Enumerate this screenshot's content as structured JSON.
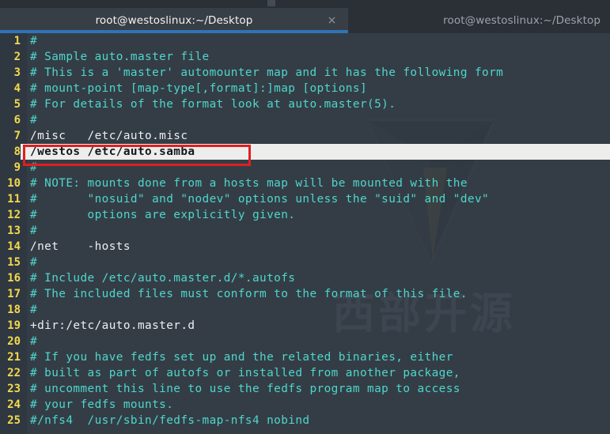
{
  "window": {
    "app": "terminal",
    "tabs": [
      {
        "label": "root@westoslinux:~/Desktop",
        "active": true,
        "close_icon": "×"
      },
      {
        "label": "root@westoslinux:~/Desktop",
        "active": false
      }
    ]
  },
  "colors": {
    "background": "#343d46",
    "gutter": "#2f3740",
    "tabbar": "#2b3036",
    "tab_active": "#383e45",
    "tab_underline": "#2f74b5",
    "line_number": "#f2d94e",
    "comment": "#4fd6cc",
    "plain_text": "#eceff1",
    "selection": "#edeeec",
    "annotation": "#e01f1f"
  },
  "watermark": {
    "text": "西部开源"
  },
  "editor": {
    "file": "auto.master",
    "highlighted_line": 8,
    "lines": [
      {
        "n": "1",
        "text": "#",
        "style": "comment"
      },
      {
        "n": "2",
        "text": "# Sample auto.master file",
        "style": "comment"
      },
      {
        "n": "3",
        "text": "# This is a 'master' automounter map and it has the following form",
        "style": "comment"
      },
      {
        "n": "4",
        "text": "# mount-point [map-type[,format]:]map [options]",
        "style": "comment"
      },
      {
        "n": "5",
        "text": "# For details of the format look at auto.master(5).",
        "style": "comment"
      },
      {
        "n": "6",
        "text": "#",
        "style": "comment"
      },
      {
        "n": "7",
        "text": "/misc\t/etc/auto.misc",
        "style": "plain"
      },
      {
        "n": "8",
        "text": "/westos /etc/auto.samba",
        "style": "selected"
      },
      {
        "n": "9",
        "text": "#",
        "style": "comment"
      },
      {
        "n": "10",
        "text": "# NOTE: mounts done from a hosts map will be mounted with the",
        "style": "comment"
      },
      {
        "n": "11",
        "text": "#       \"nosuid\" and \"nodev\" options unless the \"suid\" and \"dev\"",
        "style": "comment"
      },
      {
        "n": "12",
        "text": "#       options are explicitly given.",
        "style": "comment"
      },
      {
        "n": "13",
        "text": "#",
        "style": "comment"
      },
      {
        "n": "14",
        "text": "/net\t-hosts",
        "style": "plain"
      },
      {
        "n": "15",
        "text": "#",
        "style": "comment"
      },
      {
        "n": "16",
        "text": "# Include /etc/auto.master.d/*.autofs",
        "style": "comment"
      },
      {
        "n": "17",
        "text": "# The included files must conform to the format of this file.",
        "style": "comment"
      },
      {
        "n": "18",
        "text": "#",
        "style": "comment"
      },
      {
        "n": "19",
        "text": "+dir:/etc/auto.master.d",
        "style": "plain"
      },
      {
        "n": "20",
        "text": "#",
        "style": "comment"
      },
      {
        "n": "21",
        "text": "# If you have fedfs set up and the related binaries, either",
        "style": "comment"
      },
      {
        "n": "22",
        "text": "# built as part of autofs or installed from another package,",
        "style": "comment"
      },
      {
        "n": "23",
        "text": "# uncomment this line to use the fedfs program map to access",
        "style": "comment"
      },
      {
        "n": "24",
        "text": "# your fedfs mounts.",
        "style": "comment"
      },
      {
        "n": "25",
        "text": "#/nfs4  /usr/sbin/fedfs-map-nfs4 nobind",
        "style": "comment"
      }
    ]
  }
}
